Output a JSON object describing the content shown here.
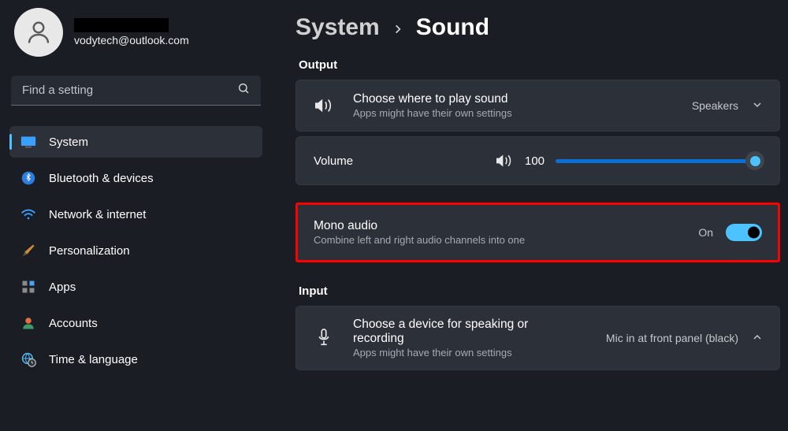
{
  "user": {
    "email": "vodytech@outlook.com"
  },
  "search": {
    "placeholder": "Find a setting"
  },
  "nav": {
    "system": "System",
    "bluetooth": "Bluetooth & devices",
    "network": "Network & internet",
    "personalization": "Personalization",
    "apps": "Apps",
    "accounts": "Accounts",
    "time": "Time & language"
  },
  "breadcrumb": {
    "parent": "System",
    "current": "Sound"
  },
  "sections": {
    "output": "Output",
    "input": "Input"
  },
  "output_card": {
    "title": "Choose where to play sound",
    "subtitle": "Apps might have their own settings",
    "value": "Speakers"
  },
  "volume": {
    "label": "Volume",
    "value": "100"
  },
  "mono": {
    "title": "Mono audio",
    "subtitle": "Combine left and right audio channels into one",
    "state": "On"
  },
  "input_card": {
    "title": "Choose a device for speaking or recording",
    "subtitle": "Apps might have their own settings",
    "value": "Mic in at front panel (black)"
  }
}
